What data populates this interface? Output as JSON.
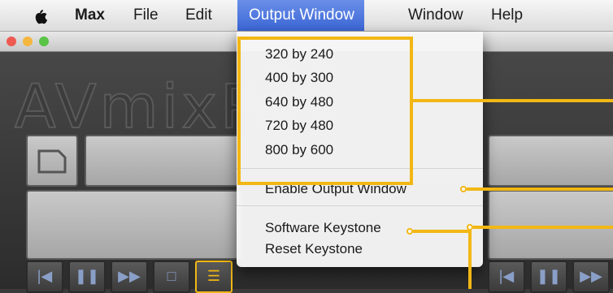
{
  "menubar": {
    "items": [
      {
        "label": "Max"
      },
      {
        "label": "File"
      },
      {
        "label": "Edit"
      },
      {
        "label": "Output Window"
      },
      {
        "label": "Window"
      },
      {
        "label": "Help"
      }
    ]
  },
  "window": {
    "logo_text": "AVmixPro",
    "traffic_light_colors": [
      "#ee5a52",
      "#f4b63f",
      "#59c346"
    ]
  },
  "menu": {
    "resolutions": [
      "320 by 240",
      "400 by 300",
      "640 by 480",
      "720 by 480",
      "800 by 600"
    ],
    "enable_output": "Enable Output Window",
    "software_keystone": "Software Keystone",
    "reset_keystone": "Reset Keystone"
  },
  "colors": {
    "callout": "#f2b714",
    "menu_highlight": "#3b66d6"
  }
}
